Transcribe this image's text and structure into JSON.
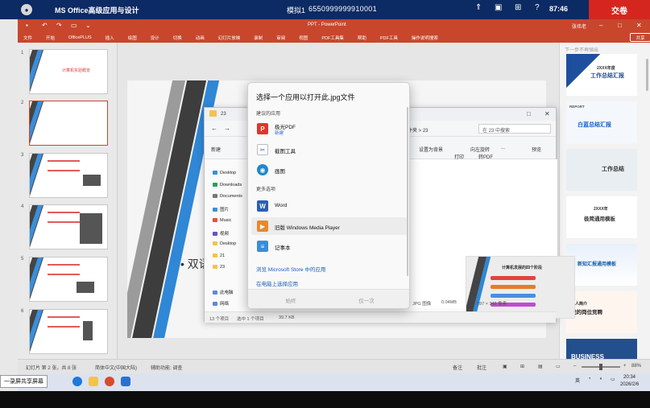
{
  "exam": {
    "subject": "MS Office高级应用与设计",
    "mock_label": "模拟1",
    "candidate_id": "6550999999910001",
    "timer": "87:46",
    "submit_label": "交卷"
  },
  "ppt": {
    "window_title": "PPT - PowerPoint",
    "user": "张伟老",
    "share_label": "共享",
    "ribbon_tabs": [
      "文件",
      "开始",
      "OfficePLUS",
      "插入",
      "绘图",
      "设计",
      "切换",
      "动画",
      "幻灯片放映",
      "录制",
      "审阅",
      "视图",
      "PDF工具集",
      "帮助",
      "PDF工具",
      "操作说明搜索"
    ],
    "slide_bullet_text": "双语",
    "thumbnails": [
      {
        "num": "1",
        "title": "计算机实验概览"
      },
      {
        "num": "2",
        "title": ""
      },
      {
        "num": "3",
        "title": ""
      },
      {
        "num": "4",
        "title": ""
      },
      {
        "num": "5",
        "title": ""
      },
      {
        "num": "6",
        "title": ""
      }
    ],
    "status": {
      "slide_info": "幻灯片 第 2 张，共 8 张",
      "language": "简体中文(中国大陆)",
      "accessibility": "辅助功能: 调查",
      "notes": "备注",
      "comments": "批注",
      "zoom": "88%"
    }
  },
  "right_panel": {
    "header": "下一步不再弹出",
    "cards": [
      {
        "title": "工作总结汇报",
        "sub": "2XXX年度"
      },
      {
        "title": "白蓝总结汇报",
        "sub": "REPORT"
      },
      {
        "title": "工作总结",
        "sub": ""
      },
      {
        "title": "极简通用模板",
        "sub": "2XXX年"
      },
      {
        "title": "新知汇报通用模板",
        "sub": ""
      },
      {
        "title": "我的岗位竞聘",
        "sub": "个人简介"
      },
      {
        "title": "BUSINESS",
        "sub": ""
      }
    ]
  },
  "explorer": {
    "title": "23",
    "crumb": "主文件夹 > 23",
    "search_placeholder": "在 23 中搜索",
    "toolbar": {
      "new": "新建",
      "sort": "排序",
      "view": "查看",
      "set_wallpaper": "设置为背景",
      "rotate_left": "向左旋转",
      "more": "...",
      "preview": "预览",
      "print": "打印",
      "to_pdf": "转PDF"
    },
    "nav_items": [
      "Desktop",
      "Downloads",
      "Documents",
      "图片",
      "Music",
      "视频",
      "Desktop",
      "21",
      "23",
      "此电脑",
      "网络"
    ],
    "preview_title": "计算机发展的四个阶段",
    "file_info": {
      "type": "JPG 图像",
      "size": "0.04MB",
      "dims": "597 × 342 像素"
    },
    "status": {
      "count": "13 个项目",
      "selected": "选中 1 个项目",
      "size": "39.7 KB"
    }
  },
  "open_with": {
    "title": "选择一个应用以打开此.jpg文件",
    "suggested_label": "建议的应用",
    "more_label": "更多选项",
    "apps": [
      {
        "name": "极光PDF",
        "sub": "新建",
        "icon": "pdf-icon",
        "color": "#e0352b"
      },
      {
        "name": "截图工具",
        "sub": "",
        "icon": "snipping-icon",
        "color": "#3f6fd1"
      },
      {
        "name": "画图",
        "sub": "",
        "icon": "paint-icon",
        "color": "#1e88c9"
      },
      {
        "name": "Word",
        "sub": "",
        "icon": "word-icon",
        "color": "#2b5fb3"
      },
      {
        "name": "旧版 Windows Media Player",
        "sub": "",
        "icon": "media-player-icon",
        "color": "#e8892b"
      },
      {
        "name": "记事本",
        "sub": "",
        "icon": "notepad-icon",
        "color": "#3a8ed6"
      }
    ],
    "store_link": "浏览 Microsoft Store 中的应用",
    "pc_link": "在电脑上选择应用",
    "btn_always": "始终",
    "btn_once": "仅一次"
  },
  "taskbar": {
    "share_tag": "一录屏共享屏幕",
    "ime": "英",
    "time": "20:34",
    "date": "2026/2/6"
  }
}
